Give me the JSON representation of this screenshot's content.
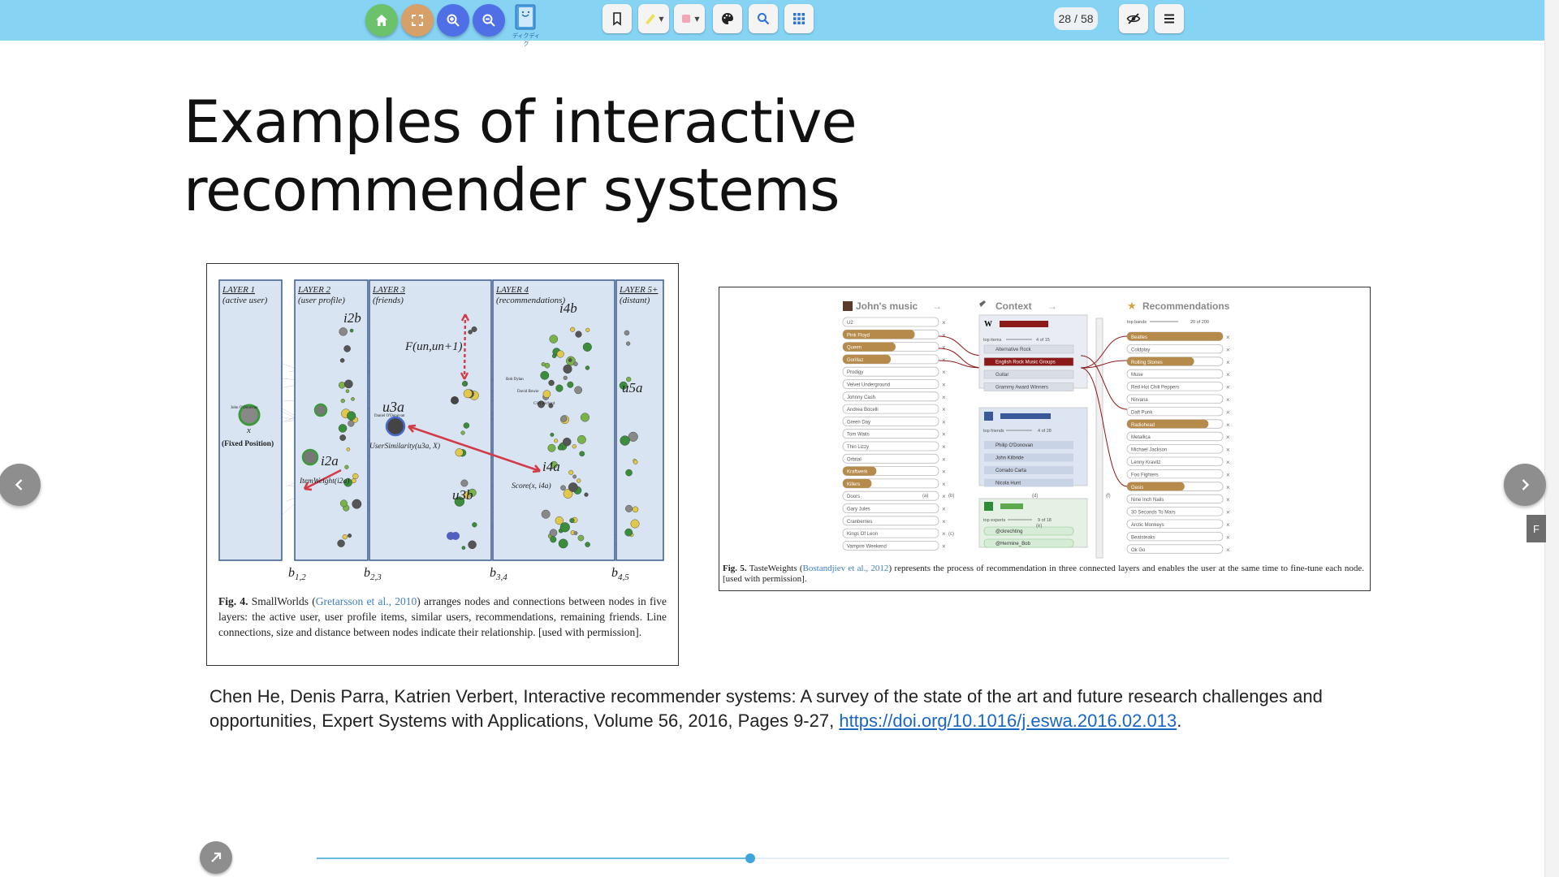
{
  "toolbar": {
    "buttons": [
      {
        "name": "home-button",
        "icon": "home-icon",
        "color": "#6cc26a"
      },
      {
        "name": "fullscreen-button",
        "icon": "fullscreen-icon",
        "color": "#d6a068"
      },
      {
        "name": "zoom-in-button",
        "icon": "zoom-in-icon",
        "color": "#4f6fe6"
      },
      {
        "name": "zoom-out-button",
        "icon": "zoom-out-icon",
        "color": "#4f6fe6"
      }
    ],
    "logo_text": "ディクディク",
    "tools": [
      "bookmark-icon",
      "highlighter-icon",
      "eraser-icon",
      "palette-icon",
      "search-icon",
      "grid-icon"
    ],
    "page_current": "28",
    "page_sep": "/",
    "page_total": "58"
  },
  "slide": {
    "title": "Examples of interactive recommender systems",
    "citation": {
      "text": "Chen He, Denis Parra, Katrien Verbert, Interactive recommender systems: A survey of the state of the art and future research challenges and opportunities, Expert Systems with Applications, Volume 56, 2016, Pages 9-27, ",
      "link": "https://doi.org/10.1016/j.eswa.2016.02.013",
      "end": "."
    }
  },
  "fig4": {
    "layers": [
      {
        "title": "LAYER 1",
        "sub": "(active user)"
      },
      {
        "title": "LAYER 2",
        "sub": "(user profile)"
      },
      {
        "title": "LAYER 3",
        "sub": "(friends)"
      },
      {
        "title": "LAYER 4",
        "sub": "(recommendations)"
      },
      {
        "title": "LAYER 5+",
        "sub": "(distant)"
      }
    ],
    "labels": {
      "i2b": "i2b",
      "i2a": "i2a",
      "u3a": "u3a",
      "u3b": "u3b",
      "i4b": "i4b",
      "i4a": "i4a",
      "u5a": "u5a",
      "x": "x",
      "fixed": "(Fixed Position)",
      "f": "F(un,un+1)",
      "user_sim": "UserSimilarity(u3a, X)",
      "item_weight": "ItemWeight(i2a)",
      "score": "Score(x, i4a)",
      "node_john": "John O'Donovan",
      "node_daniel": "Daniel O'Donovan",
      "node_bob": "Bob Dylan",
      "node_david": "David Bowie",
      "node_cliff": "Cliff Richard"
    },
    "b_labels": [
      "b1,2",
      "b2,3",
      "b3,4",
      "b4,5"
    ],
    "caption_bold": "Fig. 4.",
    "caption_pre": " SmallWorlds (",
    "caption_link": "Gretarsson et al., 2010",
    "caption_post": ") arranges nodes and connections between nodes in five layers: the active user, user profile items, similar users, recommendations, remaining friends. Line connections, size and distance between nodes indicate their relationship. [used with permission]."
  },
  "fig5": {
    "col_john": "John's music",
    "col_context": "Context",
    "col_recs": "Recommendations",
    "john_items": [
      "U2",
      "Pink Floyd",
      "Queen",
      "Gorillaz",
      "Prodigy",
      "Velvet Underground",
      "Johnny Cash",
      "Andrea Bocelli",
      "Green Day",
      "Tom Waits",
      "Thin Lizzy",
      "Orbital",
      "Kraftwerk",
      "Killers",
      "Doors",
      "Gary Jules",
      "Cranberries",
      "Kings Of Leon",
      "Vampire Weekend"
    ],
    "john_fill": [
      0,
      0.75,
      0.55,
      0.5,
      0,
      0,
      0,
      0,
      0,
      0,
      0,
      0,
      0.35,
      0.3,
      0,
      0,
      0,
      0,
      0
    ],
    "wiki_label": "W",
    "wiki_top": "top items",
    "wiki_count": "4 of 15",
    "context_items": [
      "Alternative Rock",
      "English Rock Music Groups",
      "Guitar",
      "Grammy Award Winners"
    ],
    "fb_top": "top friends",
    "fb_count": "4 of 28",
    "fb_items": [
      "Philip O'Donovan",
      "John Kilbride",
      "Corrado Carta",
      "Nicola Hunt"
    ],
    "tw_top": "top experts",
    "tw_count": "9 of 18",
    "tw_items": [
      "@ckrechting",
      "@Hermine_Bob"
    ],
    "rec_top": "top bands",
    "rec_count": "20 of 200",
    "rec_items": [
      "Beatles",
      "Coldplay",
      "Rolling Stones",
      "Muse",
      "Red Hot Chili Peppers",
      "Nirvana",
      "Daft Punk",
      "Radiohead",
      "Metallica",
      "Michael Jackson",
      "Lenny Kravitz",
      "Foo Fighters",
      "Oasis",
      "Nine Inch Nails",
      "30 Seconds To Mars",
      "Arctic Monkeys",
      "Beatsteaks",
      "Ok Go"
    ],
    "rec_fill": [
      1,
      0,
      0.7,
      0,
      0,
      0,
      0,
      0.85,
      0,
      0,
      0,
      0,
      0.6,
      0,
      0,
      0,
      0,
      0
    ],
    "letters": [
      "(a)",
      "(b)",
      "(c)",
      "(d)",
      "(e)",
      "(f)"
    ],
    "caption_bold": "Fig. 5.",
    "caption_pre": " TasteWeights (",
    "caption_link": "Bostandjiev et al., 2012",
    "caption_post": ") represents the process of recommendation in three connected layers and enables the user at the same time to fine-tune each node. [used with permission]."
  },
  "nav": {
    "prev_icon": "chevron-left-icon",
    "next_icon": "chevron-right-icon",
    "side_tab": "F"
  },
  "progress": {
    "fraction": 0.475
  }
}
